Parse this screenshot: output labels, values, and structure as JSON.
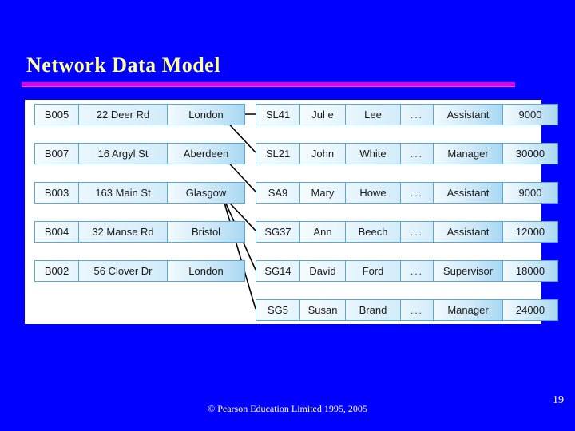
{
  "slide": {
    "title": "Network Data Model",
    "page_number": "19",
    "footer": "© Pearson Education Limited 1995, 2005",
    "colors": {
      "background": "#0000ff",
      "title_text": "#ffff99",
      "title_rule": "#e000e0",
      "panel": "#ffffff",
      "cell_border": "#5aa8d8",
      "cell_fill": "#cfe9f8",
      "footer_text": "#ffffff",
      "connector_line": "#000000"
    }
  },
  "branch_table": {
    "name": "branch-records",
    "rows": [
      {
        "id": "B005",
        "street": "22 Deer Rd",
        "city": "London"
      },
      {
        "id": "B007",
        "street": "16 Argyl St",
        "city": "Aberdeen"
      },
      {
        "id": "B003",
        "street": "163 Main St",
        "city": "Glasgow"
      },
      {
        "id": "B004",
        "street": "32 Manse Rd",
        "city": "Bristol"
      },
      {
        "id": "B002",
        "street": "56 Clover Dr",
        "city": "London"
      }
    ]
  },
  "staff_table": {
    "name": "staff-records",
    "rows": [
      {
        "id": "SL41",
        "first": "Jul e",
        "last": "Lee",
        "dots": "...",
        "position": "Assistant",
        "salary": "9000"
      },
      {
        "id": "SL21",
        "first": "John",
        "last": "White",
        "dots": "...",
        "position": "Manager",
        "salary": "30000"
      },
      {
        "id": "SA9",
        "first": "Mary",
        "last": "Howe",
        "dots": "...",
        "position": "Assistant",
        "salary": "9000"
      },
      {
        "id": "SG37",
        "first": "Ann",
        "last": "Beech",
        "dots": "...",
        "position": "Assistant",
        "salary": "12000"
      },
      {
        "id": "SG14",
        "first": "David",
        "last": "Ford",
        "dots": "...",
        "position": "Supervisor",
        "salary": "18000"
      },
      {
        "id": "SG5",
        "first": "Susan",
        "last": "Brand",
        "dots": "...",
        "position": "Manager",
        "salary": "24000"
      }
    ]
  },
  "connectors": [
    {
      "from": "B005",
      "to": "SL41"
    },
    {
      "from": "B005",
      "to": "SL21"
    },
    {
      "from": "B007",
      "to": "SA9"
    },
    {
      "from": "B003",
      "to": "SG37"
    },
    {
      "from": "B003",
      "to": "SG14"
    },
    {
      "from": "B003",
      "to": "SG5"
    }
  ]
}
